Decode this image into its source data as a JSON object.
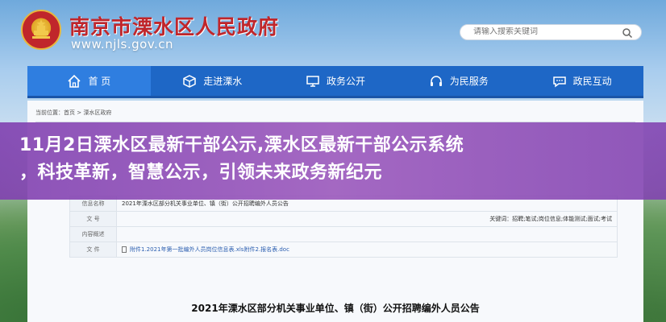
{
  "header": {
    "title": "南京市溧水区人民政府",
    "url": "www.njls.gov.cn",
    "search_placeholder": "请输入搜索关键词",
    "emblem_icon": "national-emblem-icon"
  },
  "nav": {
    "items": [
      {
        "label": "首  页",
        "icon": "home-icon"
      },
      {
        "label": "走进溧水",
        "icon": "cube-icon"
      },
      {
        "label": "政务公开",
        "icon": "monitor-icon"
      },
      {
        "label": "为民服务",
        "icon": "headset-icon"
      },
      {
        "label": "政民互动",
        "icon": "chat-icon"
      }
    ]
  },
  "content": {
    "breadcrumb": "当前位置：首页 > 溧水区政府",
    "rows": [
      {
        "key": "信息名称",
        "value": "2021年溧水区部分机关事业单位、镇（街）公开招聘编外人员公告"
      },
      {
        "key": "文    号",
        "value": ""
      },
      {
        "key": "内容概述",
        "value": ""
      },
      {
        "key": "文    件",
        "value": "附件1.2021年第一批编外人员岗位信息表.xls附件2.报名表.doc"
      }
    ],
    "keywords": "关键词：招聘;笔试;岗位信息;体能测试;面试;考试",
    "doc_title": "2021年溧水区部分机关事业单位、镇（街）公开招聘编外人员公告"
  },
  "overlay": {
    "line1": "11月2日溧水区最新干部公示,溧水区最新干部公示系统",
    "line2": "，科技革新，智慧公示，引领未来政务新纪元"
  },
  "colors": {
    "nav_bg": "#1e67c6",
    "title_red": "#c0262b",
    "overlay_purple": "#8a48b8"
  }
}
